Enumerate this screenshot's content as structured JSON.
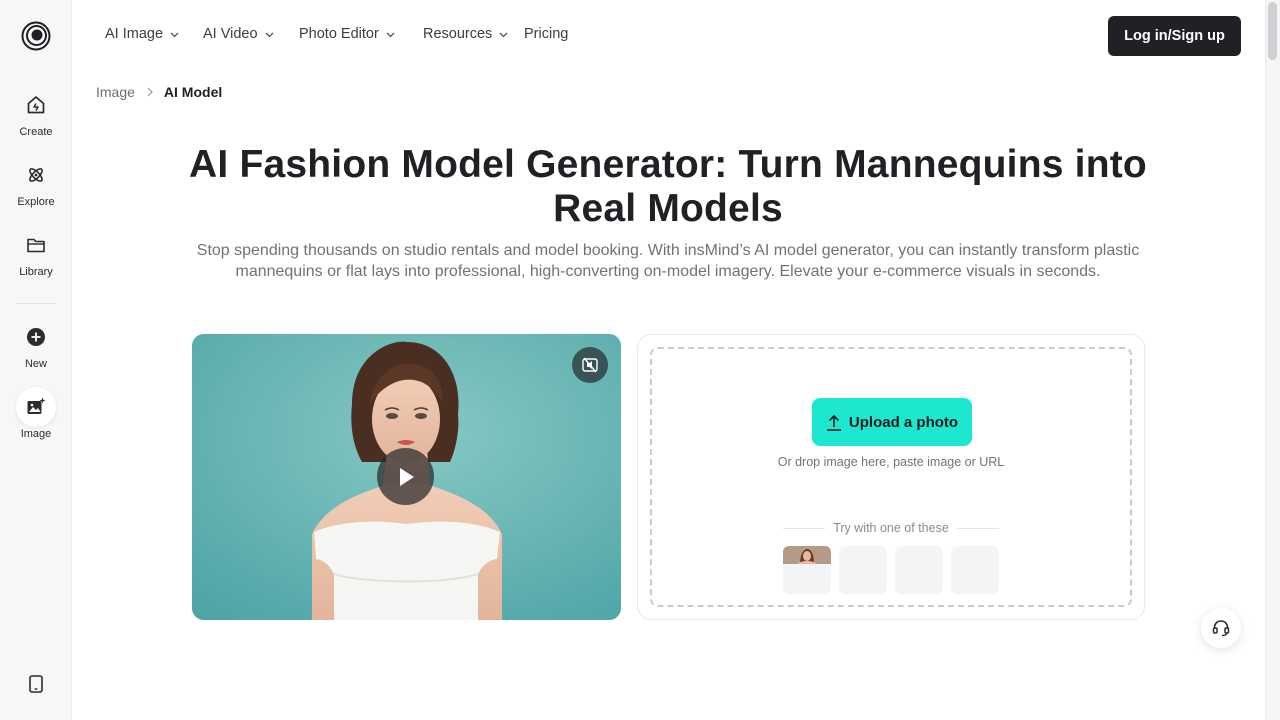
{
  "rail": {
    "logo": "insmind-logo-icon",
    "items": [
      {
        "label": "Create",
        "icon": "create-icon"
      },
      {
        "label": "Explore",
        "icon": "explore-icon"
      },
      {
        "label": "Library",
        "icon": "folder-icon"
      },
      {
        "label": "New",
        "icon": "plus-circle-icon"
      },
      {
        "label": "Image",
        "icon": "image-sparkle-icon"
      }
    ],
    "bottom_icon": "tablet-icon"
  },
  "nav": {
    "items": [
      {
        "label": "AI Image",
        "has_dropdown": true
      },
      {
        "label": "AI Video",
        "has_dropdown": true
      },
      {
        "label": "Photo Editor",
        "has_dropdown": true
      },
      {
        "label": "Resources",
        "has_dropdown": true
      },
      {
        "label": "Pricing",
        "has_dropdown": false
      }
    ],
    "login_label": "Log in/Sign up"
  },
  "breadcrumb": {
    "parent": "Image",
    "current": "AI Model"
  },
  "hero": {
    "title": "AI Fashion Model Generator: Turn Mannequins into Real Models",
    "subtitle": "Stop spending thousands on studio rentals and model booking. With insMind’s AI model generator, you can instantly transform plastic mannequins or flat lays into professional, high-converting on-model imagery. Elevate your e-commerce visuals in seconds."
  },
  "video": {
    "mute_icon": "speaker-muted-icon",
    "play_icon": "play-icon"
  },
  "upload": {
    "button_label": "Upload a photo",
    "drop_hint": "Or drop image here, paste image or URL",
    "try_label": "Try with one of these",
    "sample_count": 4
  },
  "support": {
    "icon": "headset-icon"
  },
  "colors": {
    "accent": "#1de8cf",
    "dark_button": "#1f2125",
    "video_bg": "#6fb7b4"
  }
}
